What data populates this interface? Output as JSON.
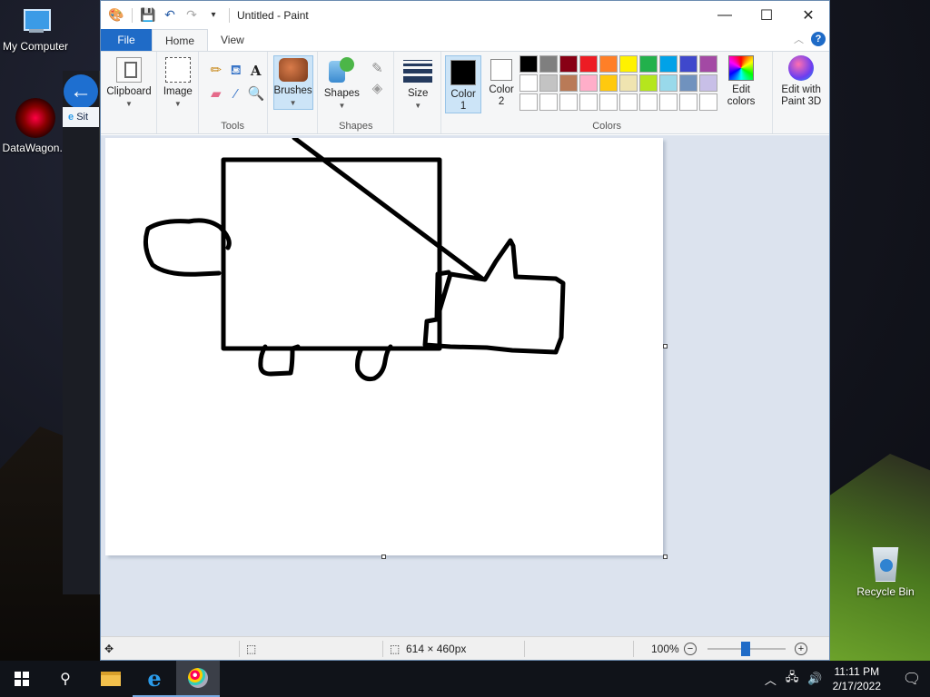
{
  "desktop": {
    "icons": [
      {
        "label": "My Computer"
      },
      {
        "label": "DataWagon..."
      },
      {
        "label": "Recycle Bin"
      }
    ],
    "ie_tab_label": "Sit"
  },
  "window": {
    "title": "Untitled - Paint",
    "controls": {
      "minimize": "—",
      "maximize": "☐",
      "close": "✕"
    }
  },
  "ribbon_tabs": {
    "file": "File",
    "home": "Home",
    "view": "View",
    "active": "Home"
  },
  "ribbon": {
    "clipboard": "Clipboard",
    "image": "Image",
    "tools_label": "Tools",
    "brushes": "Brushes",
    "shapes": "Shapes",
    "shapes_label": "Shapes",
    "size": "Size",
    "color1_line1": "Color",
    "color1_line2": "1",
    "color2_line1": "Color",
    "color2_line2": "2",
    "colors_label": "Colors",
    "edit_colors_line1": "Edit",
    "edit_colors_line2": "colors",
    "edit_p3d_line1": "Edit with",
    "edit_p3d_line2": "Paint 3D",
    "color1_value": "#000000",
    "color2_value": "#ffffff",
    "palette_row1": [
      "#000000",
      "#7f7f7f",
      "#880015",
      "#ed1c24",
      "#ff7f27",
      "#fff200",
      "#22b14c",
      "#00a2e8",
      "#3f48cc",
      "#a349a4"
    ],
    "palette_row2": [
      "#ffffff",
      "#c3c3c3",
      "#b97a57",
      "#ffaec9",
      "#ffc90e",
      "#efe4b0",
      "#b5e61d",
      "#99d9ea",
      "#7092be",
      "#c8bfe7"
    ],
    "palette_row3": [
      "#ffffff",
      "#ffffff",
      "#ffffff",
      "#ffffff",
      "#ffffff",
      "#ffffff",
      "#ffffff",
      "#ffffff",
      "#ffffff",
      "#ffffff"
    ]
  },
  "statusbar": {
    "canvas_size": "614 × 460px",
    "zoom": "100%",
    "zoom_level_percent": 100
  },
  "taskbar": {
    "time": "11:11 PM",
    "date": "2/17/2022"
  }
}
